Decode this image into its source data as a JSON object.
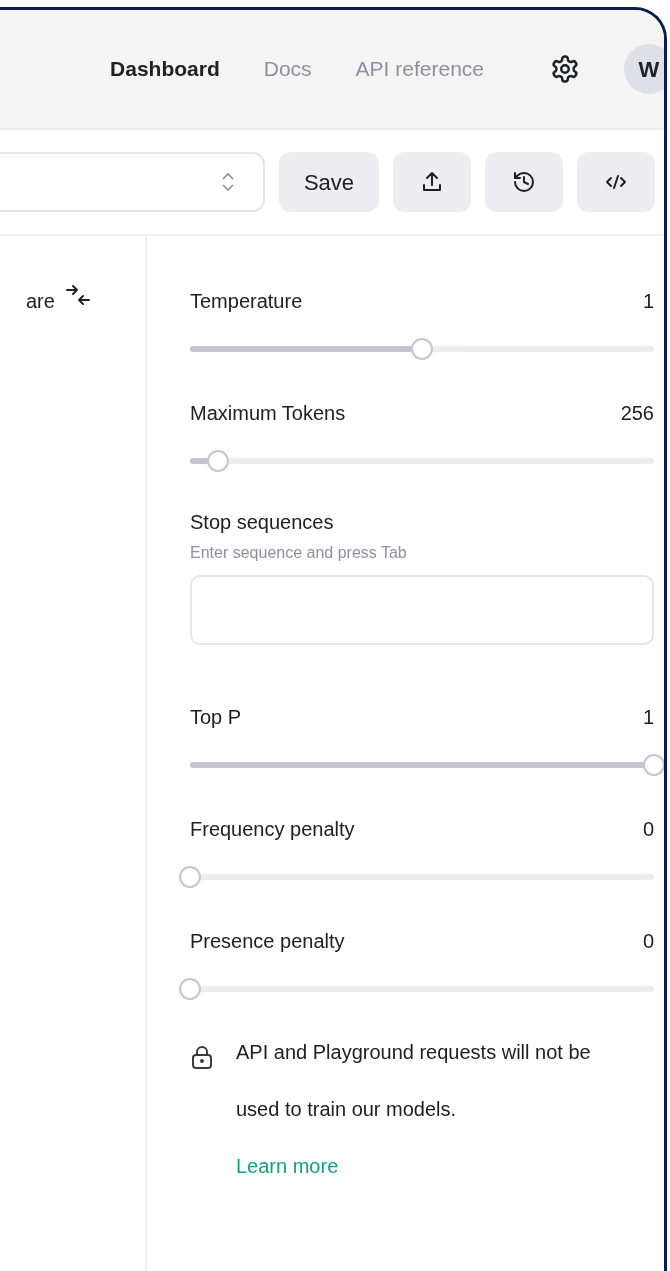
{
  "nav": {
    "links": [
      {
        "label": "Dashboard",
        "selected": true
      },
      {
        "label": "Docs",
        "selected": false
      },
      {
        "label": "API reference",
        "selected": false
      }
    ],
    "avatar": "W"
  },
  "toolbar": {
    "save": "Save"
  },
  "left_pane": {
    "compare_label": "are"
  },
  "settings": [
    {
      "kind": "slider",
      "label": "Temperature",
      "value": "1",
      "level": 0.5
    },
    {
      "kind": "slider",
      "label": "Maximum Tokens",
      "value": "256",
      "level": 0.06
    },
    {
      "kind": "field",
      "label": "Stop sequences",
      "hint": "Enter sequence and press Tab"
    },
    {
      "kind": "slider",
      "label": "Top P",
      "value": "1",
      "level": 1
    },
    {
      "kind": "slider",
      "label": "Frequency penalty",
      "value": "0",
      "level": 0
    },
    {
      "kind": "slider",
      "label": "Presence penalty",
      "value": "0",
      "level": 0
    }
  ],
  "notice": {
    "text": "API and Playground requests will not be used to train our models.",
    "link": "Learn more"
  }
}
